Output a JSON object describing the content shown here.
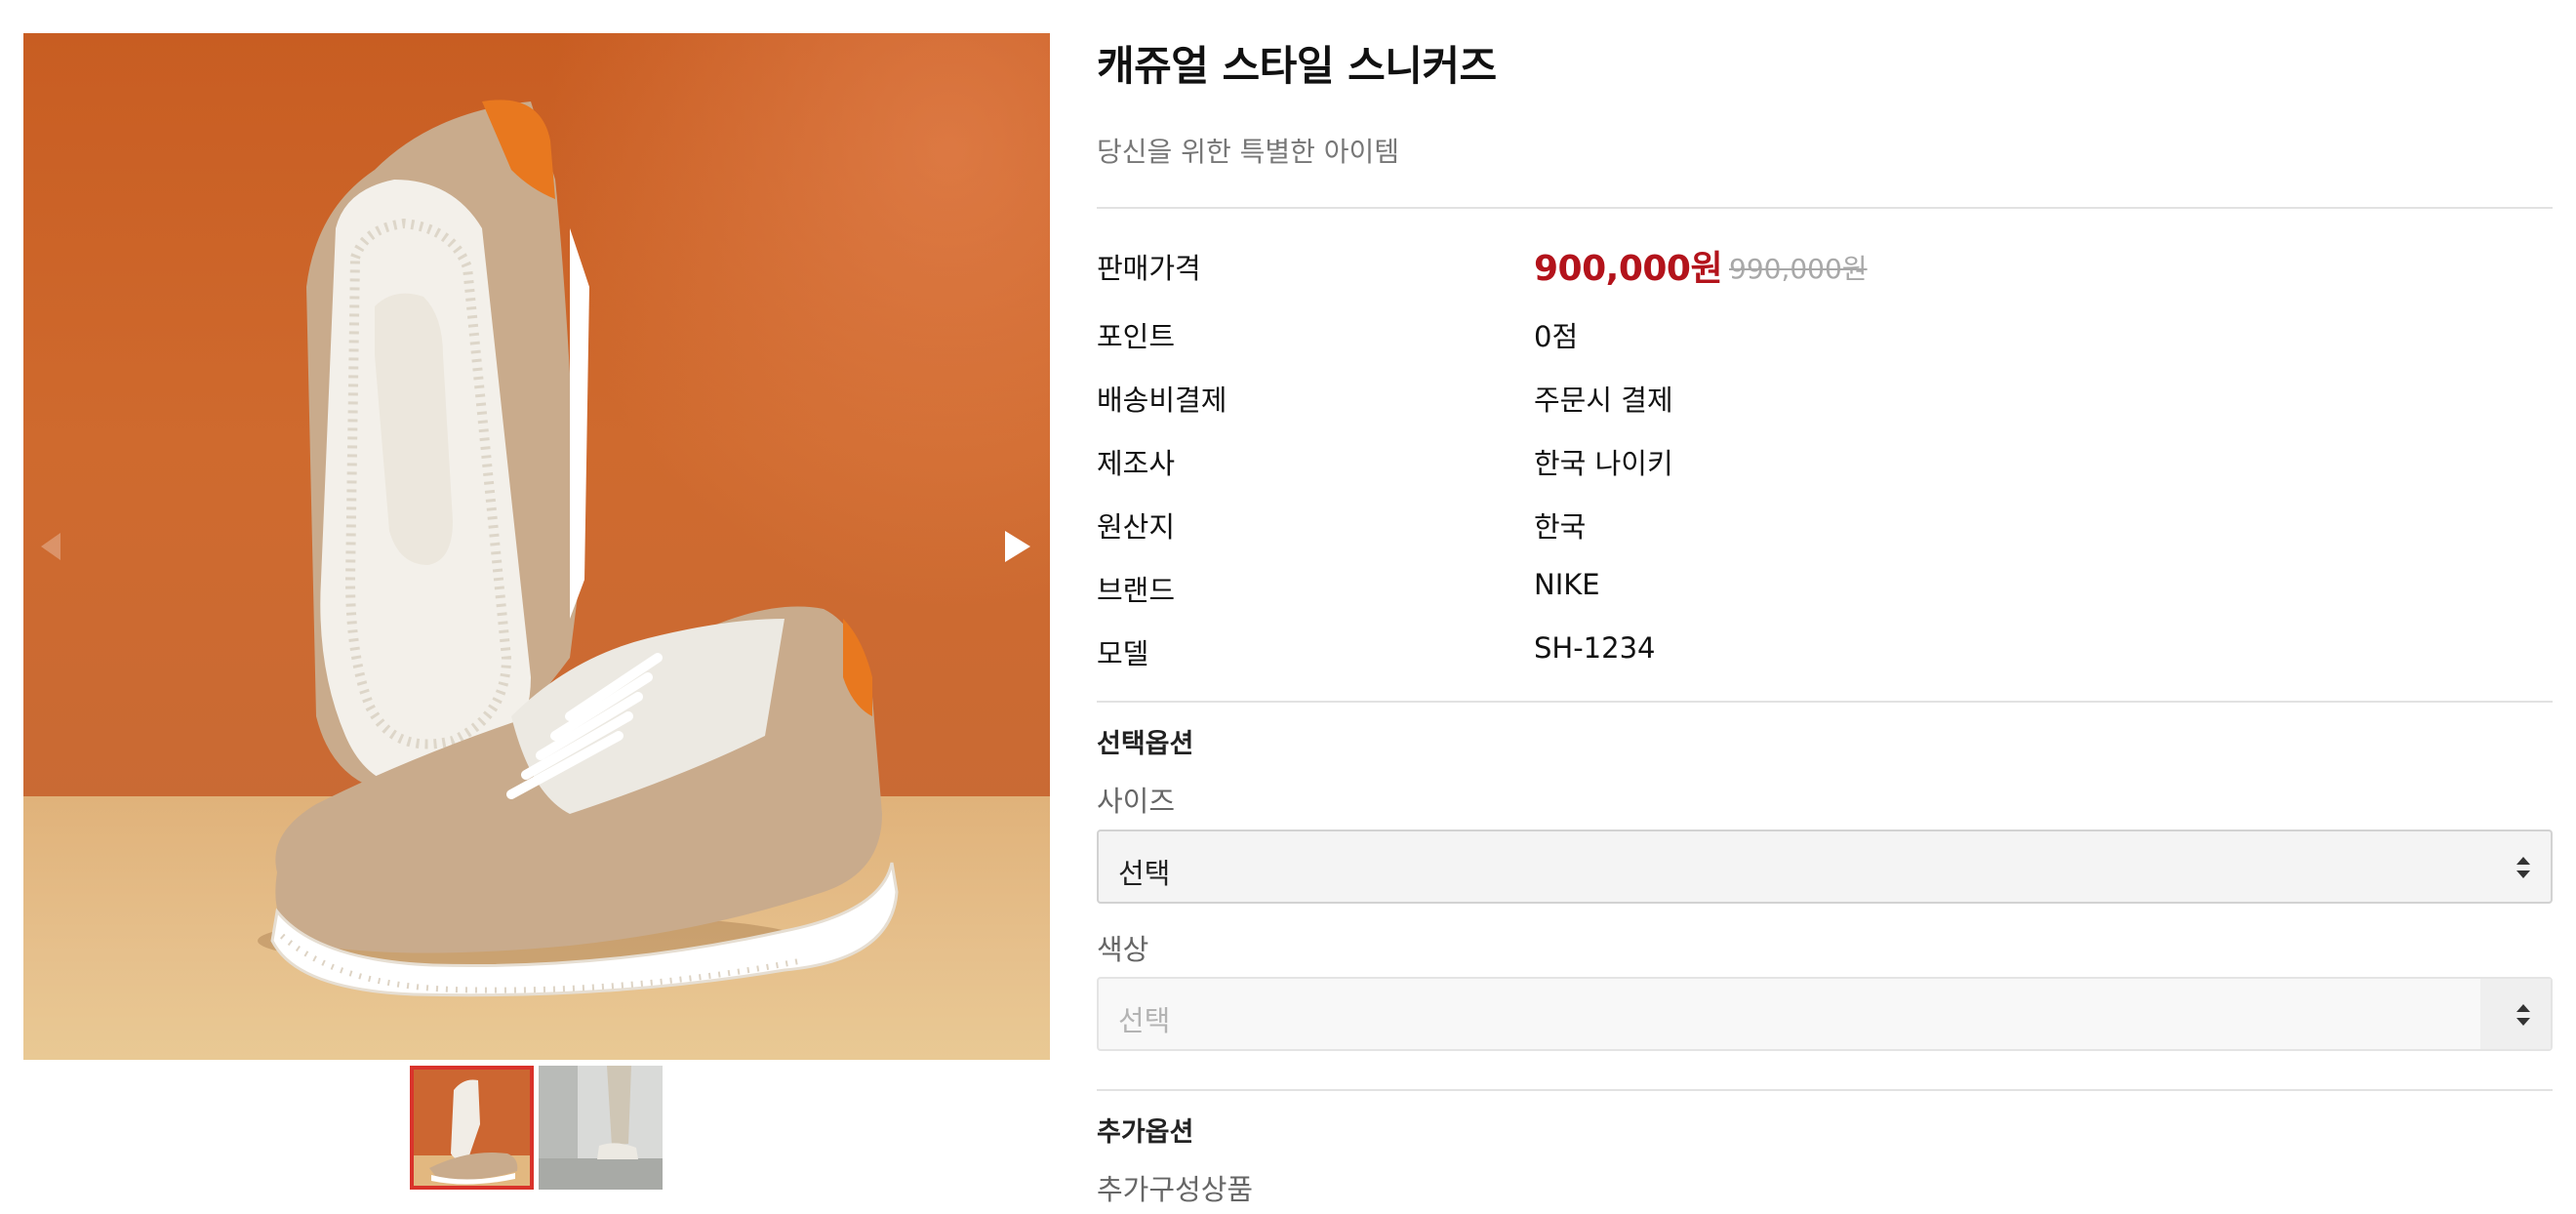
{
  "gallery": {
    "main_image_alt": "캐쥬얼 스타일 스니커즈",
    "thumbnails": [
      {
        "name": "thumb-1",
        "active": true
      },
      {
        "name": "thumb-2",
        "active": false
      }
    ],
    "icons": {
      "prev": "chevron-left-icon",
      "next": "chevron-right-icon"
    }
  },
  "product": {
    "title": "캐쥬얼 스타일 스니커즈",
    "subtitle": "당신을 위한 특별한 아이템",
    "price": {
      "label": "판매가격",
      "current": "900,000원",
      "original": "990,000원"
    },
    "info": [
      {
        "label": "포인트",
        "value": "0점"
      },
      {
        "label": "배송비결제",
        "value": "주문시 결제"
      },
      {
        "label": "제조사",
        "value": "한국 나이키"
      },
      {
        "label": "원산지",
        "value": "한국"
      },
      {
        "label": "브랜드",
        "value": "NIKE"
      },
      {
        "label": "모델",
        "value": "SH-1234"
      }
    ]
  },
  "options": {
    "section_title": "선택옵션",
    "size": {
      "label": "사이즈",
      "selected": "선택"
    },
    "color": {
      "label": "색상",
      "selected": "선택"
    }
  },
  "extra_options": {
    "section_title": "추가옵션",
    "label": "추가구성상품"
  },
  "colors": {
    "accent_price": "#b3131b",
    "thumb_active_border": "#d9332b"
  }
}
